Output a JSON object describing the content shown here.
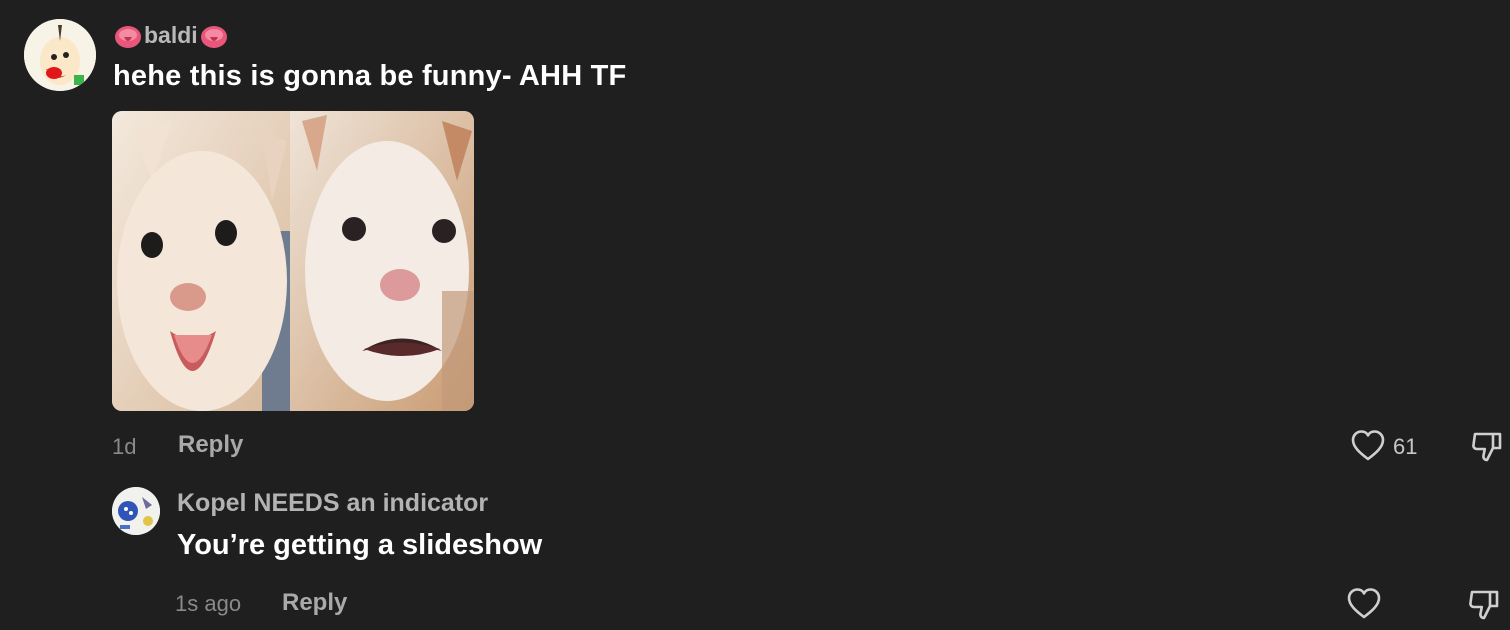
{
  "main_comment": {
    "username": "baldi",
    "username_emoji": "tongue-emoji",
    "text": "hehe this is gonna be funny- AHH TF",
    "attachment": "two-screaming-cats-image",
    "time": "1d",
    "reply_label": "Reply",
    "like_count": "61"
  },
  "reply_comment": {
    "username": "Kopel NEEDS an indicator",
    "text": "You’re getting a slideshow",
    "time": "1s ago",
    "reply_label": "Reply"
  },
  "colors": {
    "background": "#1f1f1f",
    "text_primary": "#ffffff",
    "text_secondary": "#a9a9a9"
  },
  "icons": {
    "like": "heart-icon",
    "dislike": "thumbs-down-icon"
  }
}
